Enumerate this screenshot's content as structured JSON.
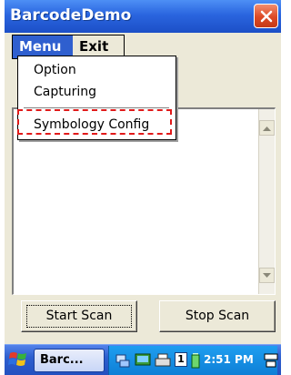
{
  "window": {
    "title": "BarcodeDemo"
  },
  "menubar": {
    "items": [
      "Menu",
      "Exit"
    ]
  },
  "dropdown": {
    "items": [
      "Option",
      "Capturing",
      "Symbology Config"
    ],
    "highlighted": "Symbology Config"
  },
  "buttons": {
    "start": "Start Scan",
    "stop": "Stop Scan"
  },
  "taskbar": {
    "app": "Barc...",
    "tray_badge": "1",
    "clock": "2:51 PM"
  },
  "colors": {
    "titlebar": "#2a65df",
    "menu_selected": "#2f5fcf",
    "highlight": "#e11a1a",
    "close_button": "#dd4a25"
  },
  "icons": [
    "close-icon",
    "scroll-up-icon",
    "scroll-down-icon",
    "windows-start-icon",
    "network-icon",
    "desktop-icon",
    "printer-icon",
    "battery-icon",
    "keyboard-icon"
  ]
}
